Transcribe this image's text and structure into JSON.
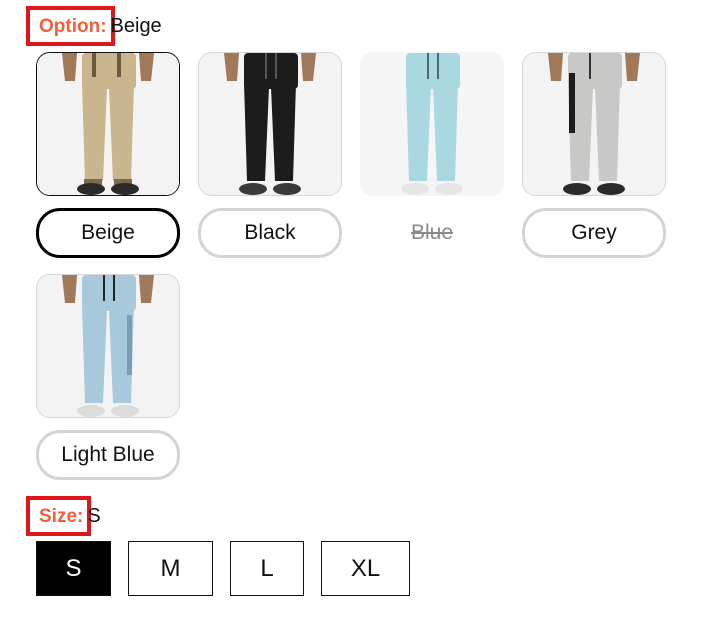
{
  "option": {
    "label": "Option:",
    "value": "Beige"
  },
  "swatches": [
    {
      "name": "Beige",
      "status": "selected",
      "pants_color": "#c9b58e"
    },
    {
      "name": "Black",
      "status": "available",
      "pants_color": "#1c1c1c"
    },
    {
      "name": "Blue",
      "status": "unavailable",
      "pants_color": "#a9d8e1"
    },
    {
      "name": "Grey",
      "status": "available",
      "pants_color": "#c8c8c6"
    },
    {
      "name": "Light Blue",
      "status": "available",
      "pants_color": "#a8c8dc"
    }
  ],
  "size": {
    "label": "Size:",
    "value": "S",
    "options": [
      "S",
      "M",
      "L",
      "XL"
    ],
    "selected": "S"
  },
  "colors": {
    "highlight_box": "#e0161b",
    "label_text": "#f0603a",
    "selected": "#000000"
  }
}
